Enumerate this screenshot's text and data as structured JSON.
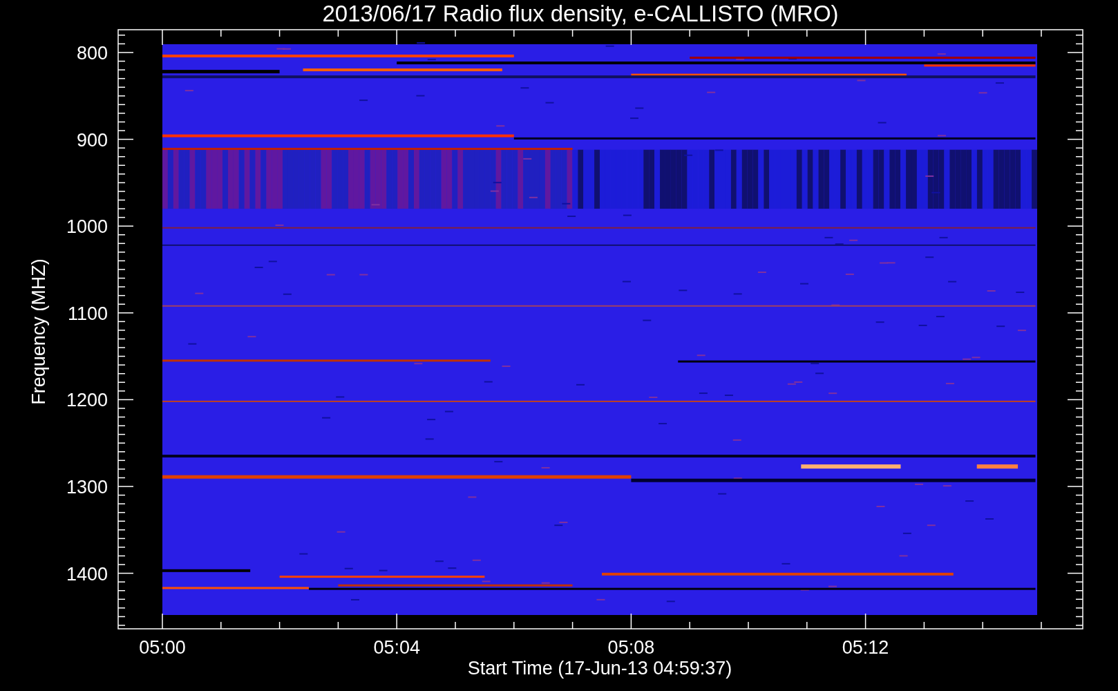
{
  "title": "2013/06/17  Radio flux density, e-CALLISTO (MRO)",
  "y_axis": {
    "label": "Frequency (MHZ)",
    "ticks": [
      "800",
      "900",
      "1000",
      "1100",
      "1200",
      "1300",
      "1400"
    ]
  },
  "x_axis": {
    "label": "Start Time (17-Jun-13 04:59:37)",
    "ticks": [
      "05:00",
      "05:04",
      "05:08",
      "05:12"
    ]
  }
}
